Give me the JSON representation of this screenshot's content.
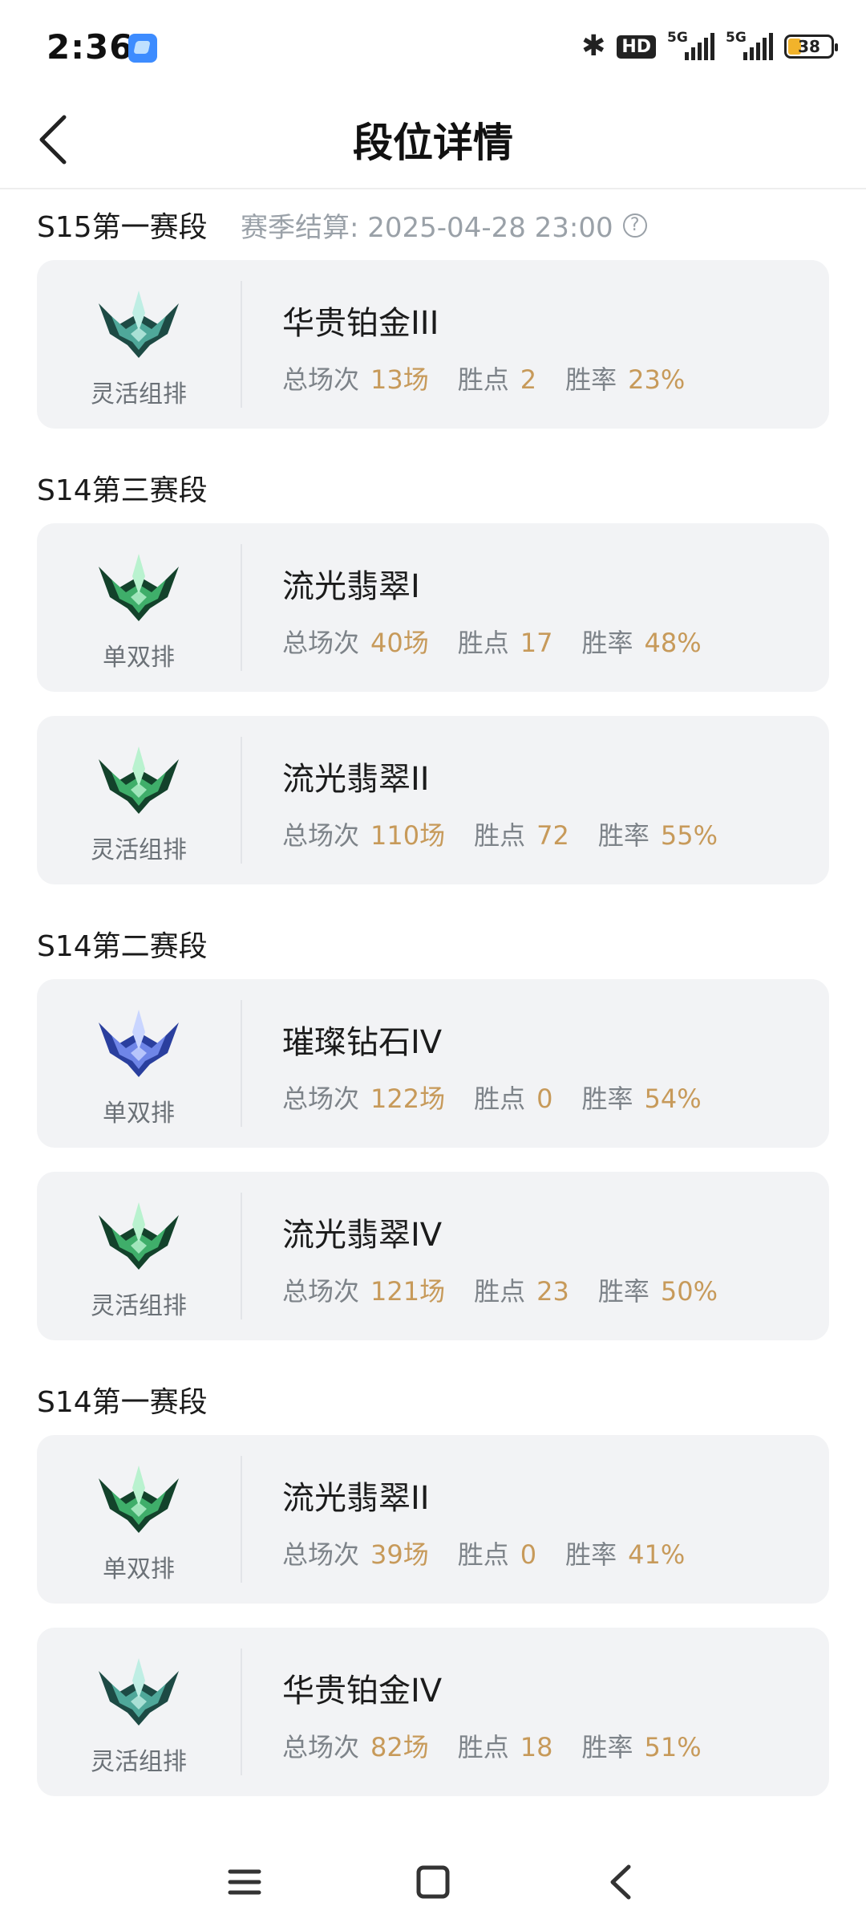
{
  "status_bar": {
    "time": "2:36",
    "hd_label": "HD",
    "network1": "5G",
    "network2": "5G",
    "battery": "38"
  },
  "header": {
    "title": "段位详情"
  },
  "colors": {
    "accent": "#c79a5a",
    "muted": "#9aa1a8",
    "card_bg": "#f2f3f5"
  },
  "seasons": [
    {
      "name": "S15第一赛段",
      "settlement": "赛季结算: 2025-04-28 23:00",
      "entries": [
        {
          "queue": "灵活组排",
          "rank": "华贵铂金III",
          "games_label": "总场次",
          "games": "13场",
          "lp_label": "胜点",
          "lp": "2",
          "wr_label": "胜率",
          "wr": "23%",
          "emblem": "platinum-emblem"
        }
      ]
    },
    {
      "name": "S14第三赛段",
      "settlement": "",
      "entries": [
        {
          "queue": "单双排",
          "rank": "流光翡翠I",
          "games_label": "总场次",
          "games": "40场",
          "lp_label": "胜点",
          "lp": "17",
          "wr_label": "胜率",
          "wr": "48%",
          "emblem": "emerald-emblem"
        },
        {
          "queue": "灵活组排",
          "rank": "流光翡翠II",
          "games_label": "总场次",
          "games": "110场",
          "lp_label": "胜点",
          "lp": "72",
          "wr_label": "胜率",
          "wr": "55%",
          "emblem": "emerald-emblem"
        }
      ]
    },
    {
      "name": "S14第二赛段",
      "settlement": "",
      "entries": [
        {
          "queue": "单双排",
          "rank": "璀璨钻石IV",
          "games_label": "总场次",
          "games": "122场",
          "lp_label": "胜点",
          "lp": "0",
          "wr_label": "胜率",
          "wr": "54%",
          "emblem": "diamond-emblem"
        },
        {
          "queue": "灵活组排",
          "rank": "流光翡翠IV",
          "games_label": "总场次",
          "games": "121场",
          "lp_label": "胜点",
          "lp": "23",
          "wr_label": "胜率",
          "wr": "50%",
          "emblem": "emerald-emblem"
        }
      ]
    },
    {
      "name": "S14第一赛段",
      "settlement": "",
      "entries": [
        {
          "queue": "单双排",
          "rank": "流光翡翠II",
          "games_label": "总场次",
          "games": "39场",
          "lp_label": "胜点",
          "lp": "0",
          "wr_label": "胜率",
          "wr": "41%",
          "emblem": "emerald-emblem"
        },
        {
          "queue": "灵活组排",
          "rank": "华贵铂金IV",
          "games_label": "总场次",
          "games": "82场",
          "lp_label": "胜点",
          "lp": "18",
          "wr_label": "胜率",
          "wr": "51%",
          "emblem": "platinum-emblem"
        }
      ]
    }
  ]
}
